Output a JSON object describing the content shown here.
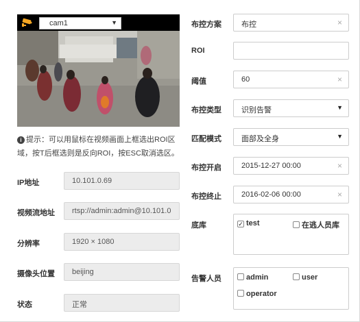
{
  "camera": {
    "selected": "cam1"
  },
  "hint": {
    "text": "提示：可以用鼠标在视频画面上框选出ROI区域，按T后框选则是反向ROI，按ESC取消选区。"
  },
  "info": {
    "ip_label": "IP地址",
    "ip_value": "10.101.0.69",
    "stream_label": "视频流地址",
    "stream_value": "rtsp://admin:admin@10.101.0",
    "resolution_label": "分辨率",
    "resolution_value": "1920 × 1080",
    "location_label": "摄像头位置",
    "location_value": "beijing",
    "status_label": "状态",
    "status_value": "正常"
  },
  "form": {
    "plan_label": "布控方案",
    "plan_value": "布控",
    "roi_label": "ROI",
    "roi_value": "",
    "threshold_label": "阈值",
    "threshold_value": "60",
    "type_label": "布控类型",
    "type_value": "识别告警",
    "match_label": "匹配模式",
    "match_value": "面部及全身",
    "start_label": "布控开启",
    "start_value": "2015-12-27 00:00",
    "end_label": "布控终止",
    "end_value": "2016-02-06 00:00",
    "library_label": "底库",
    "library_options": [
      {
        "label": "test",
        "checked": true
      },
      {
        "label": "在逃人员库",
        "checked": false
      }
    ],
    "alarm_label": "告警人员",
    "alarm_options": [
      {
        "label": "admin",
        "checked": false
      },
      {
        "label": "user",
        "checked": false
      },
      {
        "label": "operator",
        "checked": false
      }
    ]
  },
  "icons": {
    "camera": "security-camera-icon",
    "info": "info-circle-icon",
    "clear": "close-icon",
    "dropdown": "caret-down-icon",
    "check": "checkmark-icon"
  },
  "colors": {
    "camera_icon": "#f5a623",
    "readonly_bg": "#ececec"
  }
}
